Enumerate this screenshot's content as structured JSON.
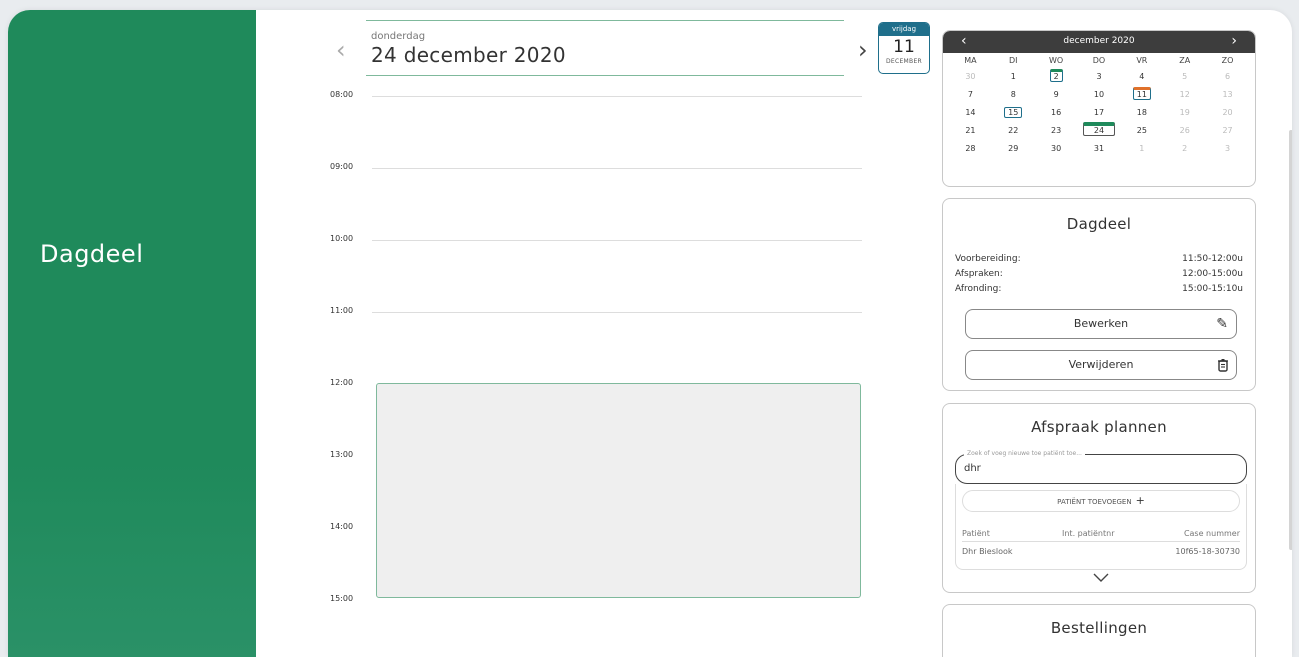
{
  "sidebar": {
    "title": "Dagdeel"
  },
  "day": {
    "weekday": "donderdag",
    "date": "24 december 2020",
    "prev_icon": "chevron-left-icon",
    "next_icon": "chevron-right-icon"
  },
  "mini_date": {
    "weekday": "vrijdag",
    "day": "11",
    "month": "DECEMBER"
  },
  "timeline": {
    "hours": [
      "08:00",
      "09:00",
      "10:00",
      "11:00",
      "12:00",
      "13:00",
      "14:00",
      "15:00"
    ]
  },
  "calendar": {
    "title": "december 2020",
    "days_of_week": [
      "MA",
      "DI",
      "WO",
      "DO",
      "VR",
      "ZA",
      "ZO"
    ],
    "weeks": [
      [
        "30",
        "1",
        "2",
        "3",
        "4",
        "5",
        "6"
      ],
      [
        "7",
        "8",
        "9",
        "10",
        "11",
        "12",
        "13"
      ],
      [
        "14",
        "15",
        "16",
        "17",
        "18",
        "19",
        "20"
      ],
      [
        "21",
        "22",
        "23",
        "24",
        "25",
        "26",
        "27"
      ],
      [
        "28",
        "29",
        "30",
        "31",
        "1",
        "2",
        "3"
      ]
    ]
  },
  "dagdeel": {
    "title": "Dagdeel",
    "rows": [
      {
        "label": "Voorbereiding:",
        "value": "11:50-12:00u"
      },
      {
        "label": "Afspraken:",
        "value": "12:00-15:00u"
      },
      {
        "label": "Afronding:",
        "value": "15:00-15:10u"
      }
    ],
    "edit_label": "Bewerken",
    "delete_label": "Verwijderen"
  },
  "plan": {
    "title": "Afspraak plannen",
    "search_legend": "Zoek of voeg nieuwe toe patiënt toe...",
    "search_value": "dhr",
    "add_label": "PATIËNT TOEVOEGEN",
    "columns": [
      "Patiënt",
      "Int. patiëntnr",
      "Case nummer"
    ],
    "results": [
      {
        "patient": "Dhr Bieslook",
        "int_nr": "",
        "case": "10f65-18-30730"
      }
    ]
  },
  "orders": {
    "title": "Bestellingen"
  }
}
